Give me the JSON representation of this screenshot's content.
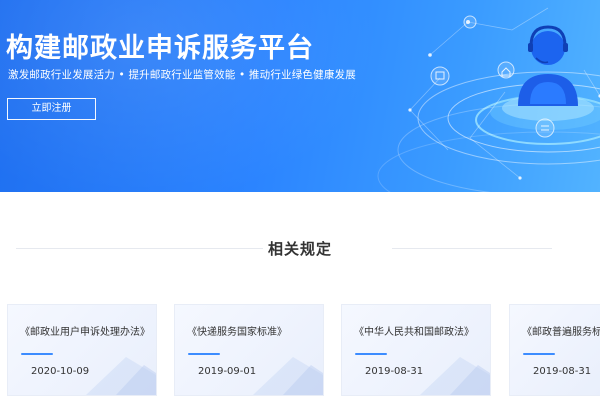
{
  "hero": {
    "title": "构建邮政业申诉服务平台",
    "subtitle": "激发邮政行业发展活力 • 提升邮政行业监管效能 • 推动行业绿色健康发展",
    "register_label": "立即注册"
  },
  "section": {
    "title": "相关规定"
  },
  "cards": [
    {
      "title": "《邮政业用户申诉处理办法》",
      "date": "2020-10-09"
    },
    {
      "title": "《快递服务国家标准》",
      "date": "2019-09-01"
    },
    {
      "title": "《中华人民共和国邮政法》",
      "date": "2019-08-31"
    },
    {
      "title": "《邮政普遍服务标准》",
      "date": "2019-08-31"
    }
  ],
  "colors": {
    "hero_start": "#1f6ff0",
    "hero_end": "#52b3ff",
    "accent": "#3c8cff",
    "card_bg": "#f0f4fd"
  }
}
